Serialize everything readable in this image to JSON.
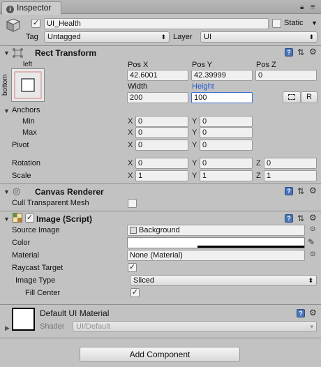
{
  "window": {
    "tab_title": "Inspector",
    "menu_icon": "menu-dots-icon"
  },
  "object": {
    "name": "UI_Health",
    "active": true,
    "static_label": "Static",
    "tag_label": "Tag",
    "tag_value": "Untagged",
    "layer_label": "Layer",
    "layer_value": "UI"
  },
  "rect_transform": {
    "title": "Rect Transform",
    "anchor_preset_h": "left",
    "anchor_preset_v": "bottom",
    "pos_x_label": "Pos X",
    "pos_y_label": "Pos Y",
    "pos_z_label": "Pos Z",
    "pos_x": "42.6001",
    "pos_y": "42.39999",
    "pos_z": "0",
    "width_label": "Width",
    "height_label": "Height",
    "width": "200",
    "height": "100",
    "blueprint_button": "",
    "raw_button": "R",
    "anchors_label": "Anchors",
    "min_label": "Min",
    "max_label": "Max",
    "anchor_min_x": "0",
    "anchor_min_y": "0",
    "anchor_max_x": "0",
    "anchor_max_y": "0",
    "pivot_label": "Pivot",
    "pivot_x": "0",
    "pivot_y": "0",
    "rotation_label": "Rotation",
    "rot_x": "0",
    "rot_y": "0",
    "rot_z": "0",
    "scale_label": "Scale",
    "scale_x": "1",
    "scale_y": "1",
    "scale_z": "1",
    "x": "X",
    "y": "Y",
    "z": "Z"
  },
  "canvas_renderer": {
    "title": "Canvas Renderer",
    "cull_label": "Cull Transparent Mesh",
    "cull_value": false
  },
  "image": {
    "title": "Image (Script)",
    "enabled": true,
    "source_image_label": "Source Image",
    "source_image_value": "Background",
    "color_label": "Color",
    "color_value": "#ffffff",
    "material_label": "Material",
    "material_value": "None (Material)",
    "raycast_label": "Raycast Target",
    "raycast_value": true,
    "image_type_label": "Image Type",
    "image_type_value": "Sliced",
    "fill_center_label": "Fill Center",
    "fill_center_value": true
  },
  "material_preview": {
    "name": "Default UI Material",
    "shader_label": "Shader",
    "shader_value": "UI/Default"
  },
  "add_component_label": "Add Component",
  "colors": {
    "panel": "#c2c2c2",
    "accent_blue": "#2157c9",
    "focus": "#3b6dd8"
  }
}
